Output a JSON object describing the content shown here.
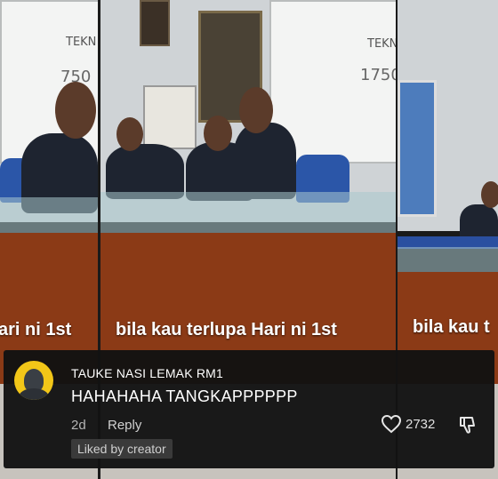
{
  "video": {
    "caption_left": "ari ni 1st",
    "caption_center": "bila kau terlupa Hari ni 1st",
    "caption_right": "bila kau t",
    "whiteboard_text_1": "TEKN",
    "whiteboard_text_2": "750",
    "whiteboard_text_3": "TEKN",
    "whiteboard_text_4": "1750"
  },
  "comment": {
    "username": "TAUKE NASI LEMAK RM1",
    "text": "HAHAHAHA TANGKAPPPPPP",
    "time": "2d",
    "reply_label": "Reply",
    "like_count": "2732",
    "liked_by_creator": "Liked by creator",
    "avatar_color": "#f2c618"
  }
}
